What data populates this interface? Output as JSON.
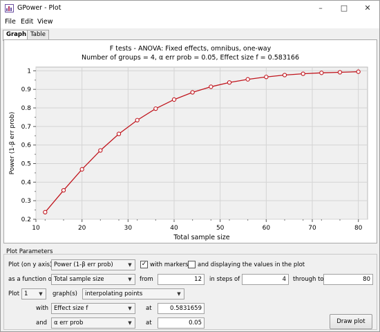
{
  "window": {
    "title": "GPower - Plot"
  },
  "menu": {
    "file": "File",
    "edit": "Edit",
    "view": "View"
  },
  "tabs": {
    "graph": "Graph",
    "table": "Table"
  },
  "chart_data": {
    "type": "line",
    "title": "F tests - ANOVA: Fixed effects, omnibus, one-way",
    "subtitle": "Number of groups = 4, α err prob = 0.05, Effect size f = 0.583166",
    "xlabel": "Total sample size",
    "ylabel": "Power (1-β err prob)",
    "xlim": [
      10,
      82
    ],
    "ylim": [
      0.2,
      1.02
    ],
    "xticks": [
      10,
      20,
      30,
      40,
      50,
      60,
      70,
      80
    ],
    "yticks": [
      0.2,
      0.3,
      0.4,
      0.5,
      0.6,
      0.7,
      0.8,
      0.9,
      1
    ],
    "grid": true,
    "markers": true,
    "line_color": "#c0141c",
    "series": [
      {
        "x": [
          12,
          16,
          20,
          24,
          28,
          32,
          36,
          40,
          44,
          48,
          52,
          56,
          60,
          64,
          68,
          72,
          76,
          80
        ],
        "values": [
          0.238,
          0.356,
          0.469,
          0.571,
          0.66,
          0.734,
          0.796,
          0.845,
          0.884,
          0.914,
          0.937,
          0.954,
          0.967,
          0.977,
          0.984,
          0.989,
          0.992,
          0.995
        ]
      }
    ]
  },
  "params": {
    "group_label": "Plot Parameters",
    "plot_on_y_label": "Plot (on y axis)",
    "y_axis_value": "Power (1-β err prob)",
    "with_markers_label": "with markers",
    "with_markers_checked": true,
    "display_values_label": "and displaying the values in the plot",
    "display_values_checked": false,
    "as_function_label": "as a function of",
    "x_axis_value": "Total sample size",
    "from_label": "from",
    "from_value": "12",
    "steps_label": "in steps of",
    "steps_value": "4",
    "through_label": "through to",
    "through_value": "80",
    "plot_label": "Plot",
    "graph_count": "1",
    "graphs_label": "graph(s)",
    "graph_mode": "interpolating points",
    "with_label": "with",
    "with_param": "Effect size f",
    "at_label_1": "at",
    "with_value": "0.5831659",
    "and_label": "and",
    "and_param": "α err prob",
    "at_label_2": "at",
    "and_value": "0.05",
    "draw_button": "Draw plot"
  }
}
